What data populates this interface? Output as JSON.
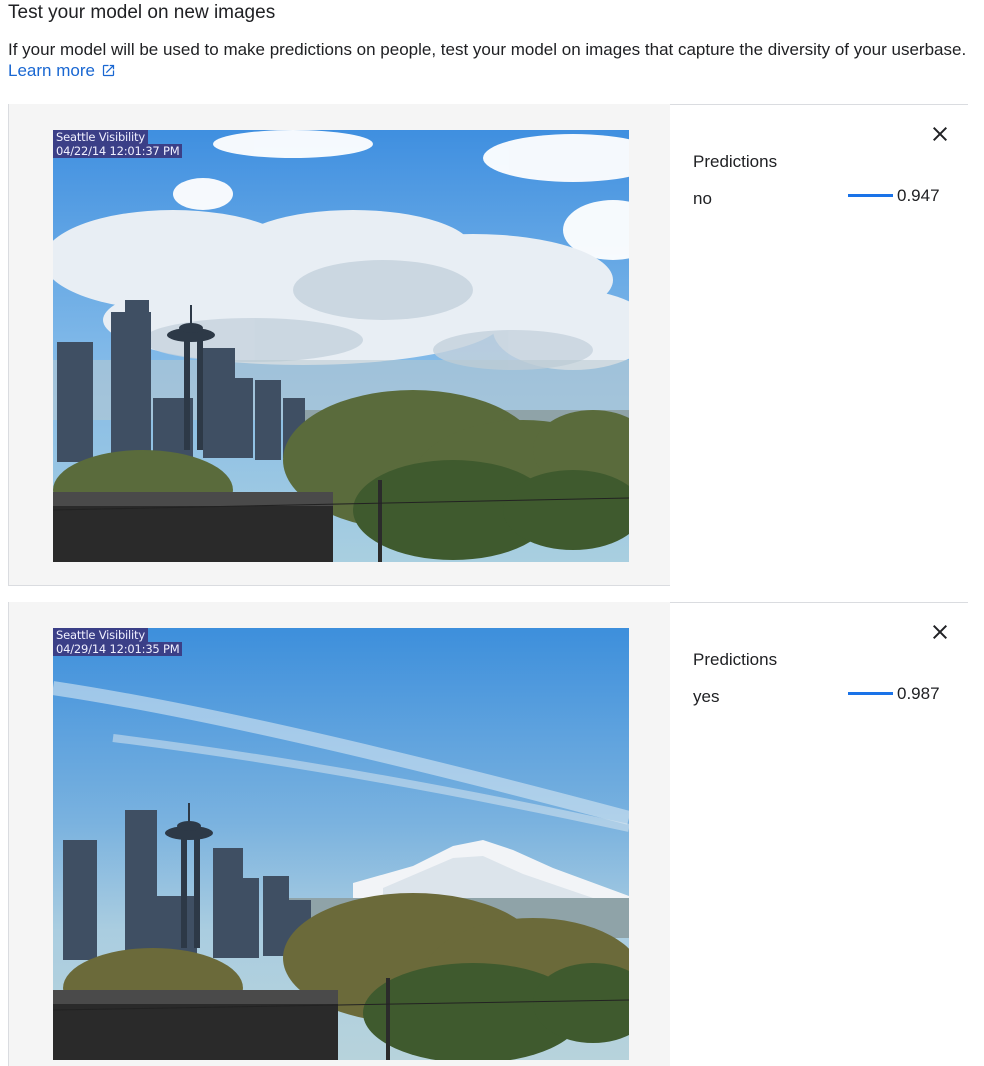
{
  "header": {
    "title": "Test your model on new images",
    "description": "If your model will be used to make predictions on people, test your model on images that capture the diversity of your userbase.",
    "learn_more": "Learn more"
  },
  "icons": {
    "external": "open-in-new-icon",
    "close": "close-icon"
  },
  "colors": {
    "link": "#1967d2",
    "bar": "#1a73e8",
    "panel_bg": "#f5f5f5"
  },
  "results": [
    {
      "stamp_line1": "Seattle Visibility",
      "stamp_line2": "04/22/14 12:01:37 PM",
      "predictions_title": "Predictions",
      "label": "no",
      "score": "0.947"
    },
    {
      "stamp_line1": "Seattle Visibility",
      "stamp_line2": "04/29/14 12:01:35 PM",
      "predictions_title": "Predictions",
      "label": "yes",
      "score": "0.987"
    }
  ]
}
